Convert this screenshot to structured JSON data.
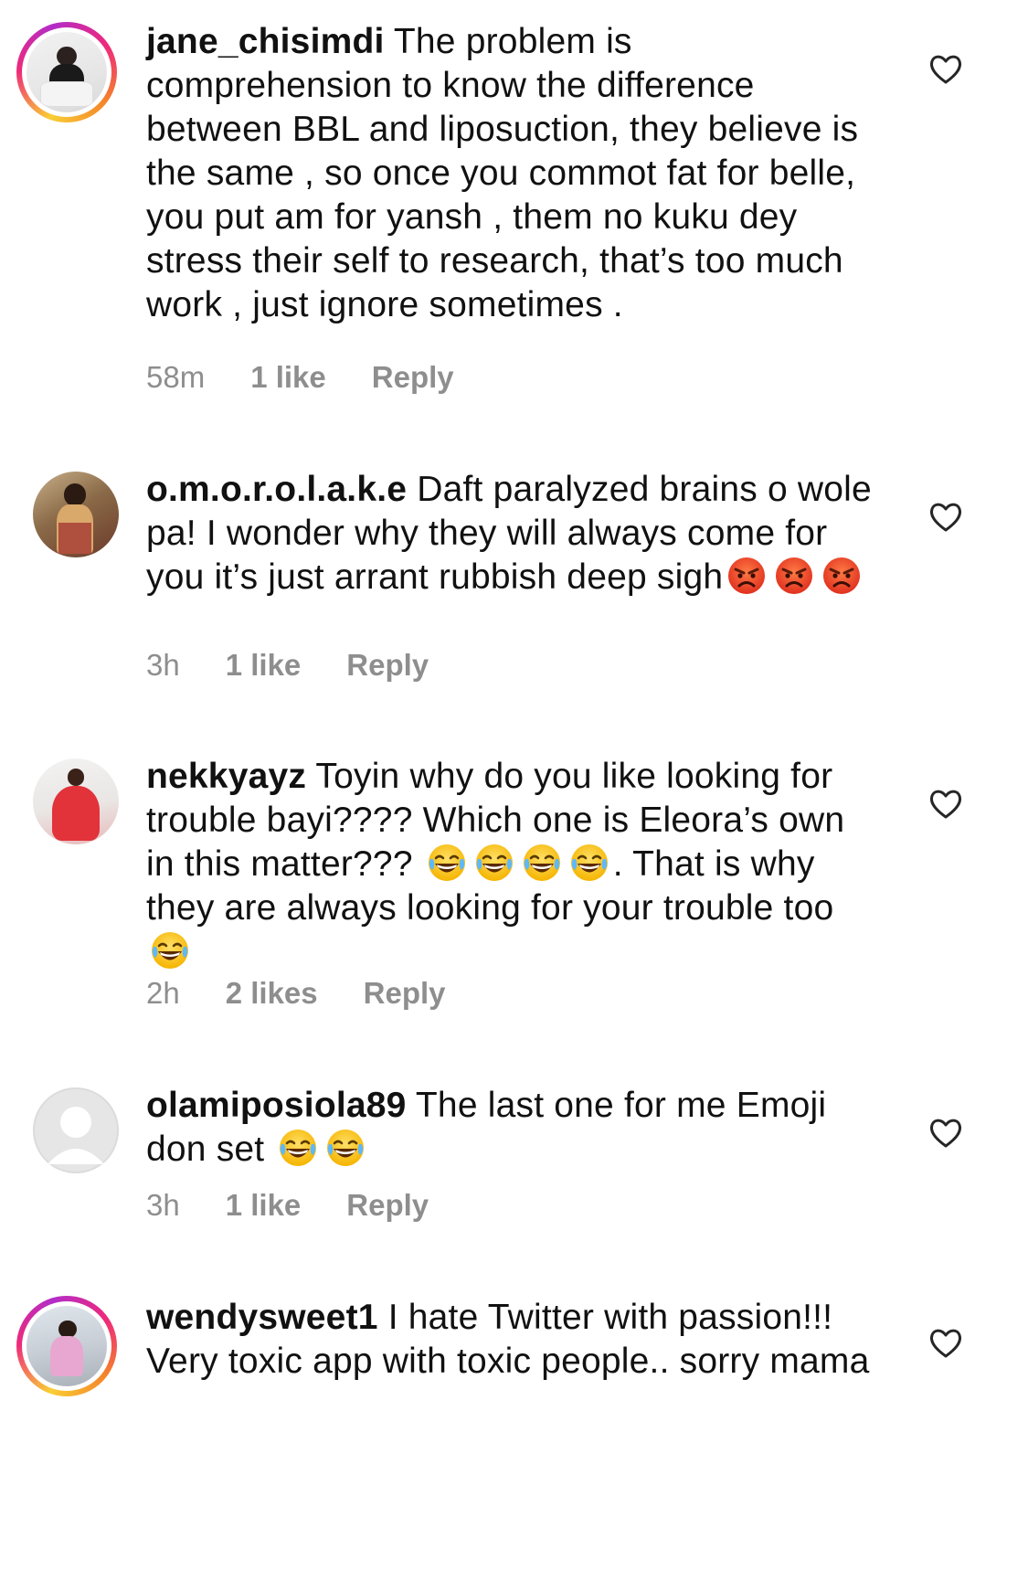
{
  "comments": [
    {
      "username": "jane_chisimdi",
      "text": "The problem is comprehension to know the difference between BBL and liposuction, they believe is the same , so once you commot fat for belle, you put am for yansh , them no kuku dey stress their self to research, that’s too much work , just ignore sometimes .",
      "time": "58m",
      "likes": "1 like",
      "reply": "Reply"
    },
    {
      "username": "o.m.o.r.o.l.a.k.e",
      "text": "Daft paralyzed brains o wole pa! I wonder why they will always come for you it’s just arrant rubbish deep sigh",
      "time": "3h",
      "likes": "1 like",
      "reply": "Reply"
    },
    {
      "username": "nekkyayz",
      "text_a": "Toyin why do you like looking for trouble bayi???? Which one is Eleora’s own in this matter???",
      "text_b": ". That is why they are always looking for your trouble too",
      "time": "2h",
      "likes": "2 likes",
      "reply": "Reply"
    },
    {
      "username": "olamiposiola89",
      "text": "The last one for me Emoji don set",
      "time": "3h",
      "likes": "1 like",
      "reply": "Reply"
    },
    {
      "username": "wendysweet1",
      "text": "I hate Twitter with passion!!! Very toxic app with toxic people.. sorry mama"
    }
  ],
  "icons": {
    "like": "heart-outline-icon",
    "angry": "angry-face-emoji",
    "laugh": "tears-of-joy-emoji",
    "default_avatar": "person-placeholder-icon"
  },
  "colors": {
    "text": "#111111",
    "meta": "#8e8e8e",
    "story_ring": [
      "#f9ce34",
      "#ee2a7b",
      "#b32cc8"
    ]
  }
}
